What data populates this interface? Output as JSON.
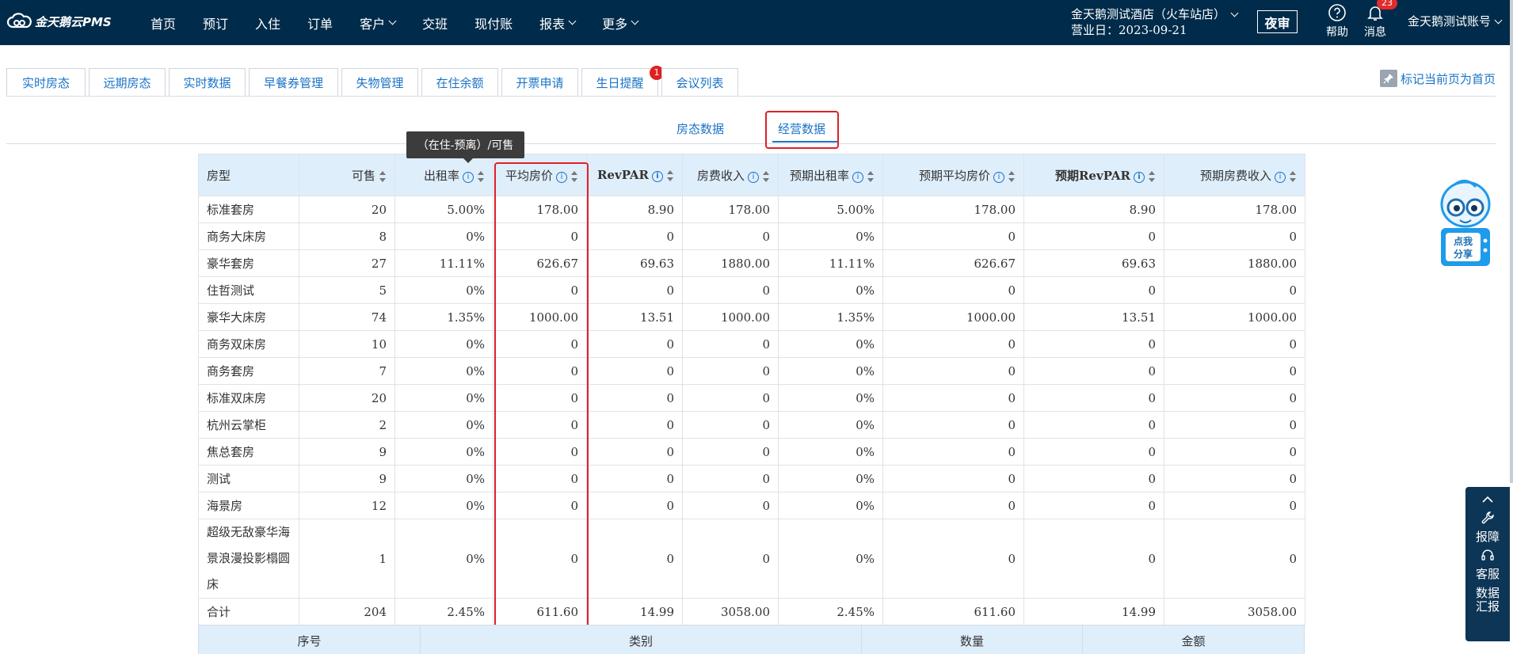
{
  "app": {
    "logo_text": "金天鹅云PMS"
  },
  "nav": [
    {
      "label": "首页",
      "dropdown": false
    },
    {
      "label": "预订",
      "dropdown": false
    },
    {
      "label": "入住",
      "dropdown": false
    },
    {
      "label": "订单",
      "dropdown": false
    },
    {
      "label": "客户",
      "dropdown": true
    },
    {
      "label": "交班",
      "dropdown": false
    },
    {
      "label": "现付账",
      "dropdown": false
    },
    {
      "label": "报表",
      "dropdown": true
    },
    {
      "label": "更多",
      "dropdown": true
    }
  ],
  "header": {
    "hotel_name": "金天鹅测试酒店（火车站店）",
    "business_date": "营业日：2023-09-21",
    "night_audit": "夜审",
    "help": "帮助",
    "messages": "消息",
    "message_count": "23",
    "account": "金天鹅测试账号"
  },
  "tabs": [
    {
      "label": "实时房态"
    },
    {
      "label": "远期房态"
    },
    {
      "label": "实时数据"
    },
    {
      "label": "早餐券管理"
    },
    {
      "label": "失物管理"
    },
    {
      "label": "在住余额"
    },
    {
      "label": "开票申请"
    },
    {
      "label": "生日提醒",
      "badge": "1"
    },
    {
      "label": "会议列表"
    }
  ],
  "pin_label": "标记当前页为首页",
  "subtabs": {
    "room_status": "房态数据",
    "business": "经营数据"
  },
  "tooltip": "（在住-预离）/可售",
  "table": {
    "headers": [
      "房型",
      "可售",
      "出租率",
      "平均房价",
      "RevPAR",
      "房费收入",
      "预期出租率",
      "预期平均房价",
      "预期RevPAR",
      "预期房费收入"
    ],
    "rows": [
      [
        "标准套房",
        "20",
        "5.00%",
        "178.00",
        "8.90",
        "178.00",
        "5.00%",
        "178.00",
        "8.90",
        "178.00"
      ],
      [
        "商务大床房",
        "8",
        "0%",
        "0",
        "0",
        "0",
        "0%",
        "0",
        "0",
        "0"
      ],
      [
        "豪华套房",
        "27",
        "11.11%",
        "626.67",
        "69.63",
        "1880.00",
        "11.11%",
        "626.67",
        "69.63",
        "1880.00"
      ],
      [
        "住哲测试",
        "5",
        "0%",
        "0",
        "0",
        "0",
        "0%",
        "0",
        "0",
        "0"
      ],
      [
        "豪华大床房",
        "74",
        "1.35%",
        "1000.00",
        "13.51",
        "1000.00",
        "1.35%",
        "1000.00",
        "13.51",
        "1000.00"
      ],
      [
        "商务双床房",
        "10",
        "0%",
        "0",
        "0",
        "0",
        "0%",
        "0",
        "0",
        "0"
      ],
      [
        "商务套房",
        "7",
        "0%",
        "0",
        "0",
        "0",
        "0%",
        "0",
        "0",
        "0"
      ],
      [
        "标准双床房",
        "20",
        "0%",
        "0",
        "0",
        "0",
        "0%",
        "0",
        "0",
        "0"
      ],
      [
        "杭州云掌柜",
        "2",
        "0%",
        "0",
        "0",
        "0",
        "0%",
        "0",
        "0",
        "0"
      ],
      [
        "焦总套房",
        "9",
        "0%",
        "0",
        "0",
        "0",
        "0%",
        "0",
        "0",
        "0"
      ],
      [
        "测试",
        "9",
        "0%",
        "0",
        "0",
        "0",
        "0%",
        "0",
        "0",
        "0"
      ],
      [
        "海景房",
        "12",
        "0%",
        "0",
        "0",
        "0",
        "0%",
        "0",
        "0",
        "0"
      ],
      [
        "超级无敌豪华海景浪漫投影榻圆床",
        "1",
        "0%",
        "0",
        "0",
        "0",
        "0%",
        "0",
        "0",
        "0"
      ]
    ],
    "total": [
      "合计",
      "204",
      "2.45%",
      "611.60",
      "14.99",
      "3058.00",
      "2.45%",
      "611.60",
      "14.99",
      "3058.00"
    ]
  },
  "sub_table": {
    "headers": [
      "序号",
      "类别",
      "数量",
      "金额"
    ]
  },
  "mascot": {
    "label_line1": "点我",
    "label_line2": "分享"
  },
  "toolbar": {
    "report": "报障",
    "service": "客服",
    "data_line1": "数据",
    "data_line2": "汇报"
  },
  "colors": {
    "navbar": "#002b4a",
    "link": "#1a73c7",
    "header_bg": "#dfeefb",
    "highlight": "#e0202a",
    "badge": "#e02020"
  }
}
